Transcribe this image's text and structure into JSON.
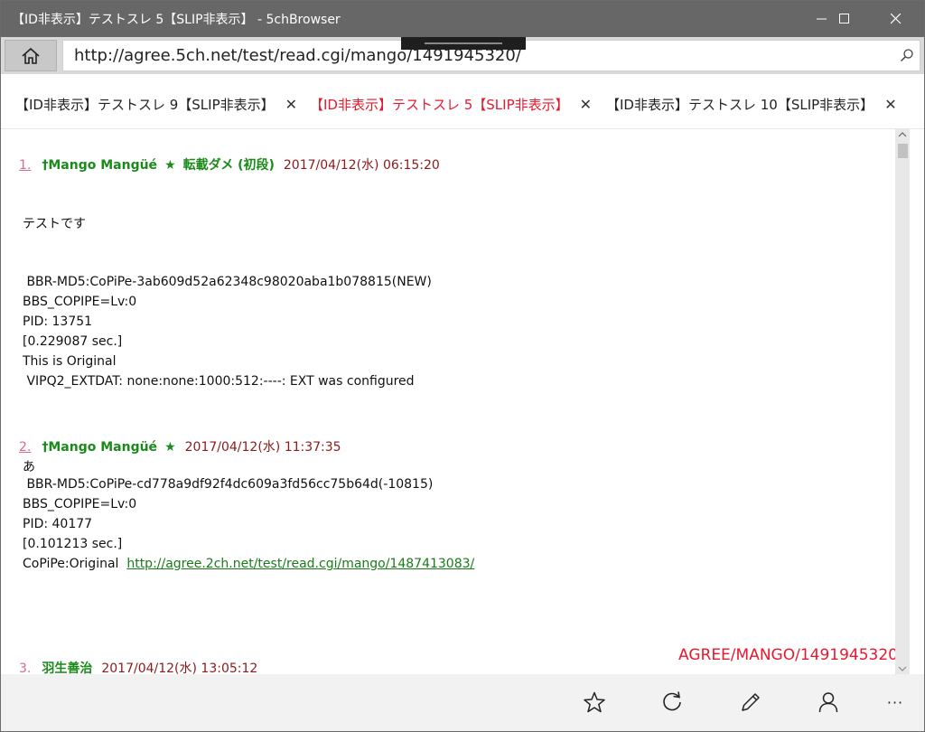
{
  "window": {
    "title": "【ID非表示】テストスレ 5【SLIP非表示】 - 5chBrowser"
  },
  "address": {
    "url": "http://agree.5ch.net/test/read.cgi/mango/1491945320/"
  },
  "tabs": [
    {
      "label": "【ID非表示】テストスレ 9【SLIP非表示】",
      "close": "✕"
    },
    {
      "label": "【ID非表示】テストスレ 5【SLIP非表示】",
      "close": "✕"
    },
    {
      "label": "【ID非表示】テストスレ 10【SLIP非表示】",
      "close": "✕"
    }
  ],
  "posts": [
    {
      "num": "1.",
      "name": "†Mango Mangüé",
      "star": "★",
      "trip": "転載ダメ (初段)",
      "date": "2017/04/12(水) 06:15:20",
      "lines": [
        "テストです",
        " BBR-MD5:CoPiPe-3ab609d52a62348c98020aba1b078815(NEW)",
        "BBS_COPIPE=Lv:0",
        "PID: 13751",
        "[0.229087 sec.]",
        "This is Original",
        " VIPQ2_EXTDAT: none:none:1000:512:----: EXT was configured"
      ]
    },
    {
      "num": "2.",
      "name": "†Mango Mangüé",
      "star": "★",
      "date": "2017/04/12(水) 11:37:35",
      "lines": [
        "あ",
        " BBR-MD5:CoPiPe-cd778a9df92f4dc609a3fd56cc75b64d(-10815)",
        "BBS_COPIPE=Lv:0",
        "PID: 40177",
        "[0.101213 sec.]",
        "CoPiPe:Original  "
      ],
      "link": "http://agree.2ch.net/test/read.cgi/mango/1487413083/"
    },
    {
      "num": "3.",
      "name": "羽生善治",
      "date": "2017/04/12(水) 13:05:12"
    }
  ],
  "thread_id": "AGREE/MANGO/1491945320",
  "toolbar": {
    "icons": [
      "star-icon",
      "refresh-icon",
      "pencil-icon",
      "person-icon",
      "more-icon"
    ],
    "more_label": "···"
  }
}
